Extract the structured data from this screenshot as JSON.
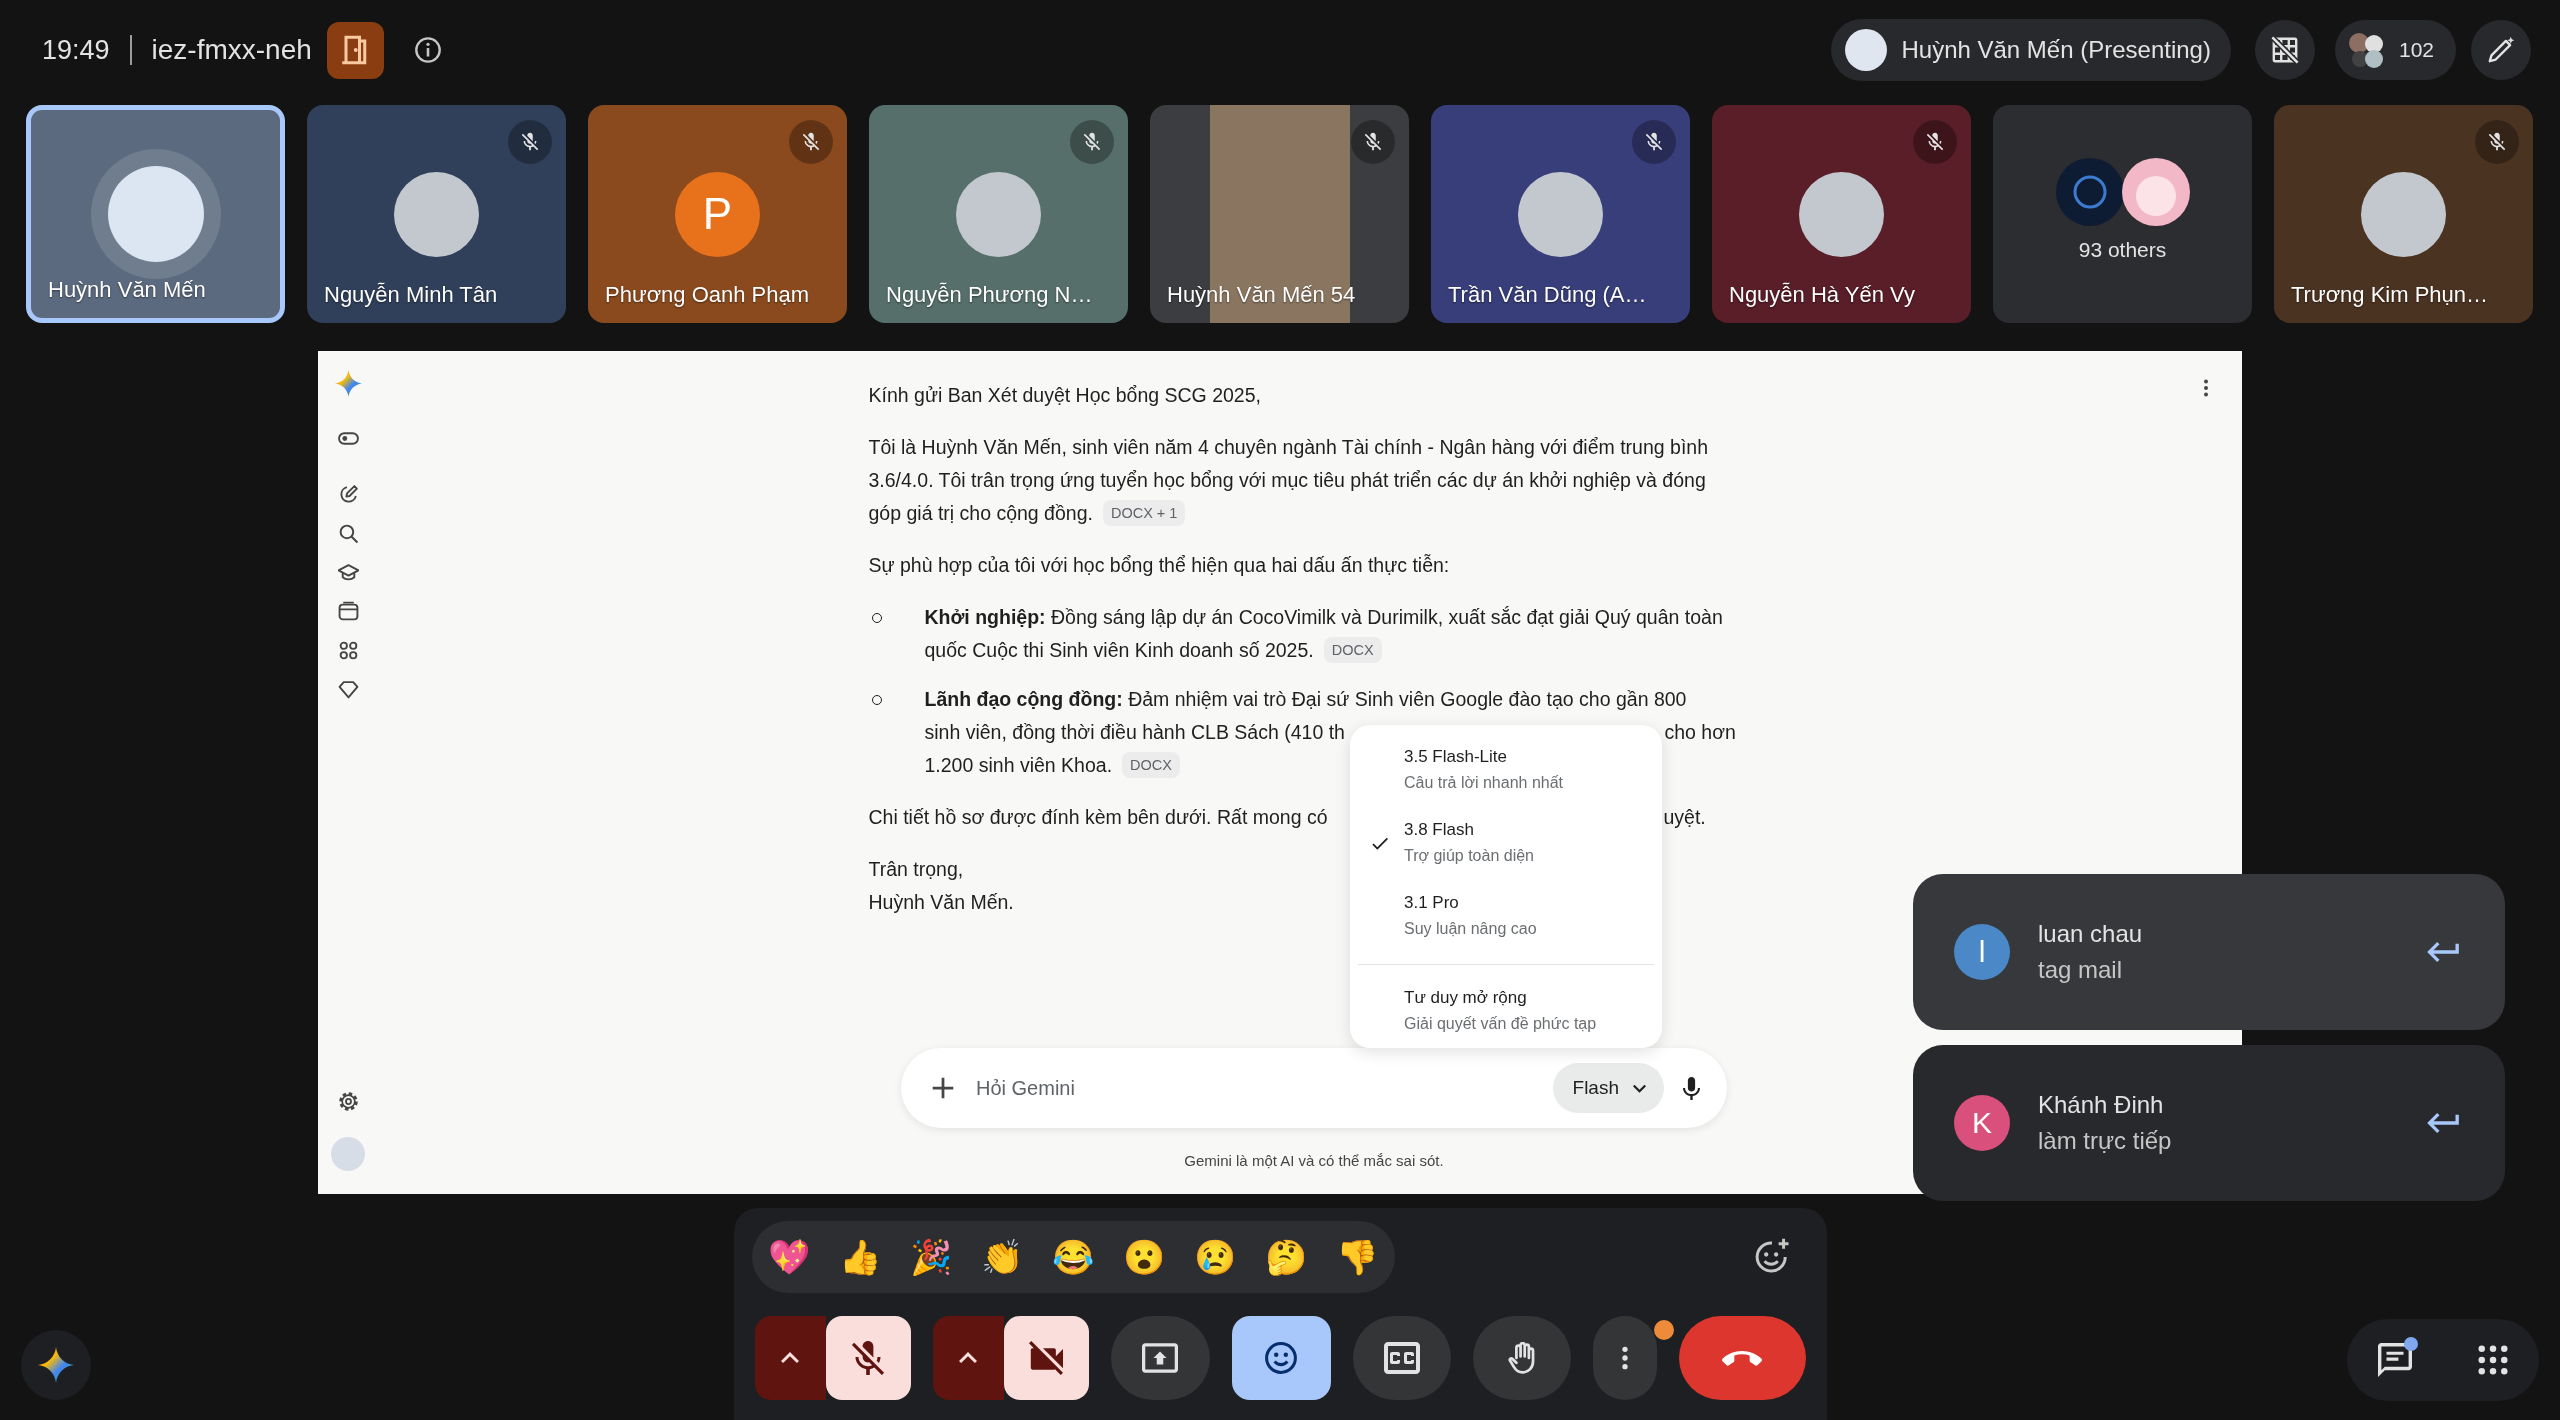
{
  "top_bar": {
    "time": "19:49",
    "meeting_code": "iez-fmxx-neh",
    "presenter": "Huỳnh Văn Mến (Presenting)",
    "participant_count": "102"
  },
  "participants": [
    {
      "kind": "photo",
      "name": "Huỳnh Văn Mến",
      "speaking": true,
      "muted": false,
      "color": "#5b6a7e"
    },
    {
      "kind": "photo",
      "name": "Nguyễn Minh Tân",
      "speaking": false,
      "muted": true,
      "color": "#30405a"
    },
    {
      "kind": "letter",
      "name": "Phương Oanh Phạm",
      "initial": "P",
      "speaking": false,
      "muted": true,
      "color": "#8b4a1e"
    },
    {
      "kind": "photo",
      "name": "Nguyễn Phương N…",
      "speaking": false,
      "muted": true,
      "color": "#566f6a"
    },
    {
      "kind": "video",
      "name": "Huỳnh Văn Mến 54",
      "speaking": false,
      "muted": true,
      "color": "#3c3d40"
    },
    {
      "kind": "photo",
      "name": "Trần Văn Dũng (A…",
      "speaking": false,
      "muted": true,
      "color": "#383e7a"
    },
    {
      "kind": "photo",
      "name": "Nguyễn Hà Yến Vy",
      "speaking": false,
      "muted": true,
      "color": "#5a1e28"
    },
    {
      "kind": "others",
      "label": "93 others"
    },
    {
      "kind": "photo",
      "name": "Trương Kim Phụn…",
      "speaking": false,
      "muted": true,
      "color": "#4b3322"
    }
  ],
  "shared_screen": {
    "paragraphs": [
      {
        "kind": "text",
        "text": "Kính gửi Ban Xét duyệt Học bổng SCG 2025,"
      },
      {
        "kind": "text",
        "lines": [
          {
            "text": "Tôi là Huỳnh Văn Mến, sinh viên năm 4 chuyên ngành Tài chính - Ngân hàng với điểm trung bình"
          },
          {
            "text": "3.6/4.0. Tôi trân trọng ứng tuyển học bổng với mục tiêu phát triển các dự án khởi nghiệp và đóng"
          },
          {
            "text": "góp giá trị cho cộng đồng.",
            "chip": "DOCX + 1"
          }
        ]
      },
      {
        "kind": "text",
        "text": "Sự phù hợp của tôi với học bổng thể hiện qua hai dấu ấn thực tiễn:"
      },
      {
        "kind": "bullet",
        "lines": [
          {
            "text": "**Khởi nghiệp:** Đồng sáng lập dự án CocoVimilk và Durimilk, xuất sắc đạt giải Quý quân toàn"
          },
          {
            "text": "quốc Cuộc thi Sinh viên Kinh doanh số 2025.",
            "chip": "DOCX"
          }
        ]
      },
      {
        "kind": "bullet",
        "lines": [
          {
            "text": "**Lãnh đạo cộng đồng:** Đảm nhiệm vai trò Đại sứ Sinh viên Google đào tạo cho gần 800"
          },
          {
            "text": "sinh viên, đồng thời điều hành CLB Sách (410 th",
            "text_after_menu": "cho hơn"
          },
          {
            "text": "1.200 sinh viên Khoa.",
            "chip": "DOCX"
          }
        ]
      },
      {
        "kind": "text",
        "lines": [
          {
            "text": "Chi tiết hồ sơ được đính kèm bên dưới. Rất mong có",
            "text_after_menu": "uyệt."
          }
        ]
      },
      {
        "kind": "text",
        "lines": [
          {
            "text": "Trân trọng,"
          },
          {
            "text": "Huỳnh Văn Mến."
          }
        ]
      }
    ],
    "model_menu": {
      "items": [
        {
          "title": "3.5 Flash-Lite",
          "subtitle": "Câu trả lời nhanh nhất",
          "selected": false,
          "divider_before": false
        },
        {
          "title": "3.8 Flash",
          "subtitle": "Trợ giúp toàn diện",
          "selected": true,
          "divider_before": false
        },
        {
          "title": "3.1 Pro",
          "subtitle": "Suy luận nâng cao",
          "selected": false,
          "divider_before": false
        },
        {
          "title": "Tư duy mở rộng",
          "subtitle": "Giải quyết vấn đề phức tạp",
          "selected": false,
          "divider_before": true
        }
      ]
    },
    "composer": {
      "placeholder": "Hỏi Gemini",
      "model": "Flash"
    },
    "disclaimer": "Gemini là một AI và có thể mắc sai sót."
  },
  "notifications": [
    {
      "name": "luan chau",
      "message": "tag mail",
      "initial": "l",
      "color": "#4a88c8",
      "highlighted": true
    },
    {
      "name": "Khánh Đinh",
      "message": "làm trực tiếp",
      "initial": "K",
      "color": "#d9507d",
      "highlighted": false
    }
  ],
  "reactions": [
    "💖",
    "👍",
    "🎉",
    "👏",
    "😂",
    "😮",
    "😢",
    "🤔",
    "👎"
  ],
  "controls": {
    "mic_muted": true,
    "camera_off": true,
    "reactions_open": true,
    "more_badge": true,
    "chat_badge": true
  }
}
